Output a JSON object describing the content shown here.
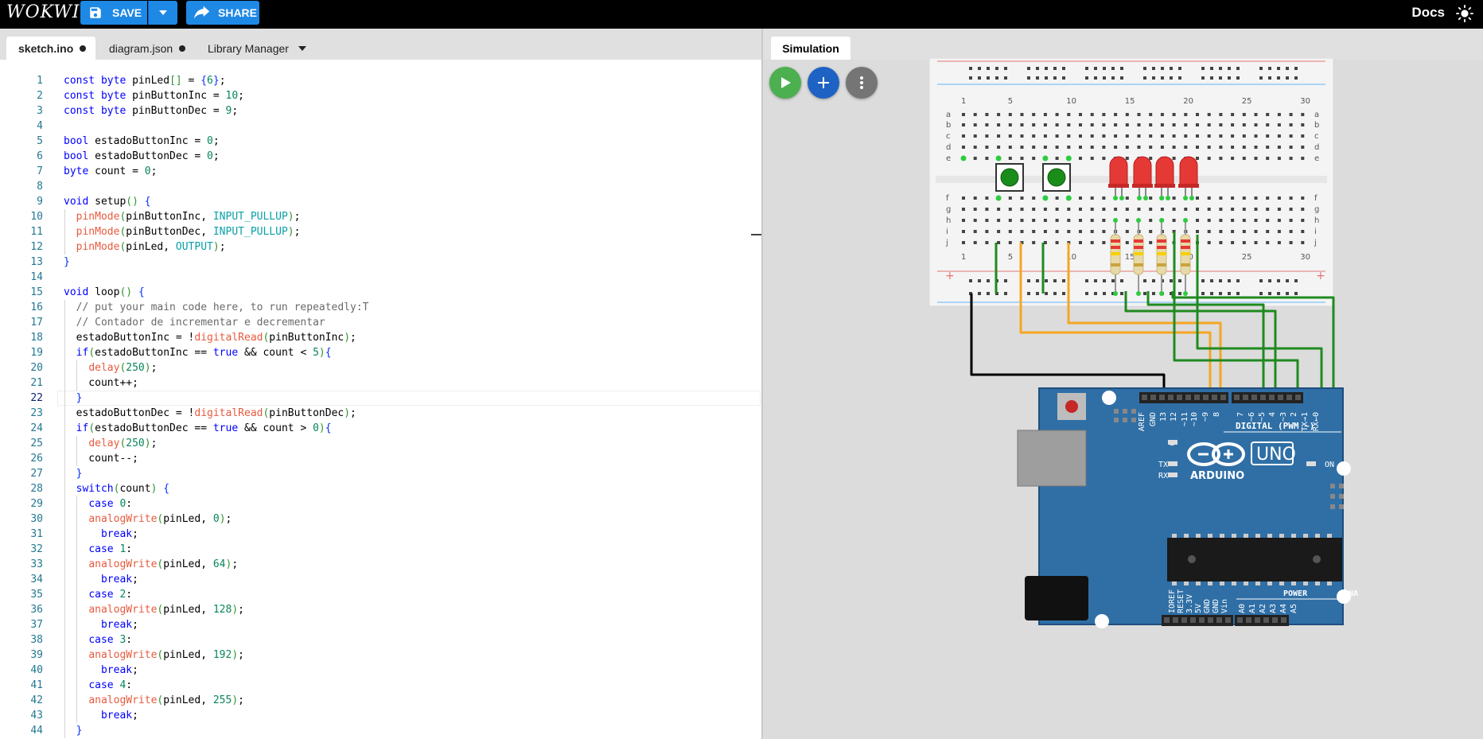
{
  "app": {
    "logo": "WOKWI",
    "save_label": "SAVE",
    "share_label": "SHARE",
    "docs_label": "Docs"
  },
  "tabs": [
    {
      "label": "sketch.ino",
      "modified": true
    },
    {
      "label": "diagram.json",
      "modified": true
    },
    {
      "label": "Library Manager"
    }
  ],
  "simulation": {
    "tab_label": "Simulation",
    "play_icon": "play-icon",
    "add_icon": "plus-icon",
    "more_icon": "more-vert-icon"
  },
  "code": {
    "current_line": 22,
    "lines": [
      "const byte pinLed[] = {6};",
      "const byte pinButtonInc = 10;",
      "const byte pinButtonDec = 9;",
      "",
      "bool estadoButtonInc = 0;",
      "bool estadoButtonDec = 0;",
      "byte count = 0;",
      "",
      "void setup() {",
      "  pinMode(pinButtonInc, INPUT_PULLUP);",
      "  pinMode(pinButtonDec, INPUT_PULLUP);",
      "  pinMode(pinLed, OUTPUT);",
      "}",
      "",
      "void loop() {",
      "  // put your main code here, to run repeatedly:T",
      "  // Contador de incrementar e decrementar",
      "  estadoButtonInc = !digitalRead(pinButtonInc);",
      "  if(estadoButtonInc == true && count < 5){",
      "    delay(250);",
      "    count++;",
      "  }",
      "  estadoButtonDec = !digitalRead(pinButtonDec);",
      "  if(estadoButtonDec == true && count > 0){",
      "    delay(250);",
      "    count--;",
      "  }",
      "  switch(count) {",
      "    case 0:",
      "    analogWrite(pinLed, 0);",
      "      break;",
      "    case 1:",
      "    analogWrite(pinLed, 64);",
      "      break;",
      "    case 2:",
      "    analogWrite(pinLed, 128);",
      "      break;",
      "    case 3:",
      "    analogWrite(pinLed, 192);",
      "      break;",
      "    case 4:",
      "    analogWrite(pinLed, 255);",
      "      break;",
      "  }"
    ]
  },
  "breadboard": {
    "column_numbers": [
      "1",
      "5",
      "10",
      "15",
      "20",
      "25",
      "30"
    ],
    "row_letters_top": [
      "a",
      "b",
      "c",
      "d",
      "e"
    ],
    "row_letters_bottom": [
      "f",
      "g",
      "h",
      "i",
      "j"
    ],
    "plus": "+"
  },
  "arduino": {
    "board_label": "UNO",
    "brand": "ARDUINO",
    "digital_label": "DIGITAL (PWM ~)",
    "digital_pins": [
      "AREF",
      "GND",
      "13",
      "12",
      "~11",
      "~10",
      "~9",
      "8",
      "7",
      "~6",
      "~5",
      "4",
      "~3",
      "2",
      "TX→1",
      "RX←0"
    ],
    "power_label": "POWER",
    "power_pins": [
      "IOREF",
      "RESET",
      "3.3V",
      "5V",
      "GND",
      "GND",
      "Vin"
    ],
    "analog_label": "ANALOG IN",
    "analog_pins": [
      "A0",
      "A1",
      "A2",
      "A3",
      "A4",
      "A5"
    ],
    "led_labels": [
      "L",
      "TX",
      "RX",
      "ON"
    ]
  },
  "colors": {
    "accent": "#1e88e5",
    "board": "#2f6fa6",
    "wire_green": "#1f8a1f",
    "wire_orange": "#f5a623",
    "wire_black": "#000000",
    "led_red": "#e53935"
  }
}
